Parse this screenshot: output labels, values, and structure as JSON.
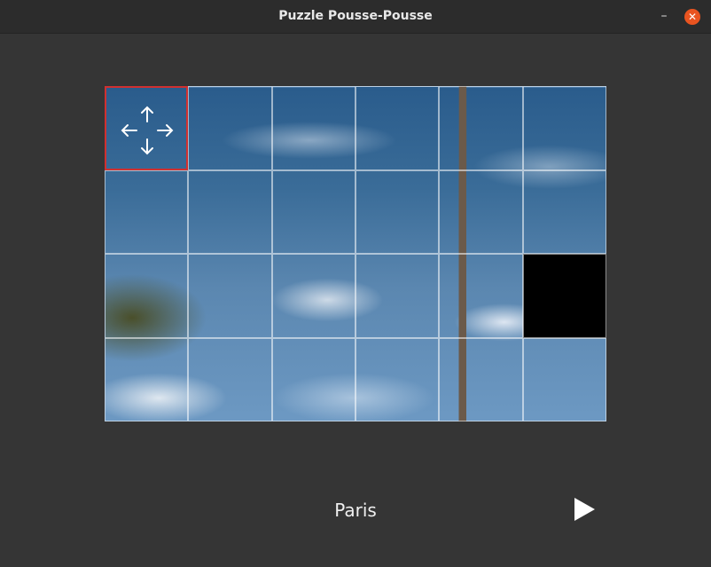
{
  "window": {
    "title": "Puzzle Pousse-Pousse",
    "minimize_glyph": "–",
    "close_glyph": "✕",
    "close_color": "#e95420"
  },
  "puzzle": {
    "columns": 6,
    "rows": 4,
    "empty_tile": {
      "row": 2,
      "col": 5
    },
    "selected_tile": {
      "row": 0,
      "col": 0
    },
    "selected_color": "#d03030",
    "cursor_icon": "move-arrows-icon"
  },
  "caption": "Paris",
  "play_icon": "play-icon"
}
